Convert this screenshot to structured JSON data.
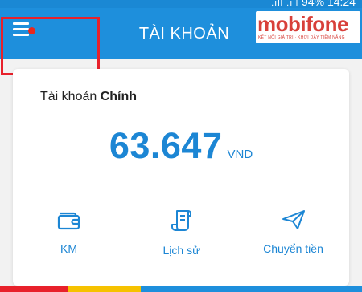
{
  "status_bar": {
    "signal_icons": ".ıll .ıll",
    "battery": "94%",
    "time": "14:24"
  },
  "header": {
    "menu_icon": "hamburger-menu-icon",
    "notification_dot_color": "#e8281e",
    "title": "TÀI KHOẢN",
    "logo": {
      "name": "mobifone",
      "tagline": "KẾT NỐI GIÁ TRỊ · KHƠI DẬY TIỀM NĂNG"
    },
    "background_color": "#1e8fdc"
  },
  "account": {
    "label_prefix": "Tài khoản",
    "label_type": "Chính",
    "balance": "63.647",
    "currency": "VND",
    "accent_color": "#1c86d4"
  },
  "actions": [
    {
      "label": "KM",
      "icon": "wallet-icon"
    },
    {
      "label": "Lịch sử",
      "icon": "receipt-scroll-icon"
    },
    {
      "label": "Chuyển tiền",
      "icon": "paper-plane-icon"
    }
  ],
  "annotation": {
    "highlight_color": "#e8212b"
  }
}
